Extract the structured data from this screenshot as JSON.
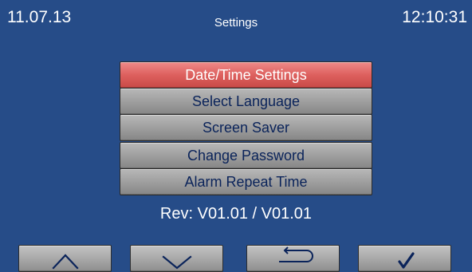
{
  "header": {
    "date": "11.07.13",
    "title": "Settings",
    "time": "12:10:31"
  },
  "menu": {
    "items": [
      {
        "label": "Date/Time Settings",
        "selected": true
      },
      {
        "label": "Select Language",
        "selected": false
      },
      {
        "label": "Screen Saver",
        "selected": false
      },
      {
        "label": "Change Password",
        "selected": false
      },
      {
        "label": "Alarm Repeat Time",
        "selected": false
      }
    ]
  },
  "revision": {
    "text": "Rev: V01.01 / V01.01"
  },
  "footer": {
    "buttons": [
      {
        "icon": "up-arrow-icon"
      },
      {
        "icon": "down-arrow-icon"
      },
      {
        "icon": "return-arrow-icon"
      },
      {
        "icon": "check-icon"
      }
    ]
  },
  "colors": {
    "background": "#264c88",
    "text_primary": "#ffffff",
    "menu_text": "#0a235a",
    "selected_item": "#dd605e",
    "button_gray": "#a8a8a8"
  }
}
